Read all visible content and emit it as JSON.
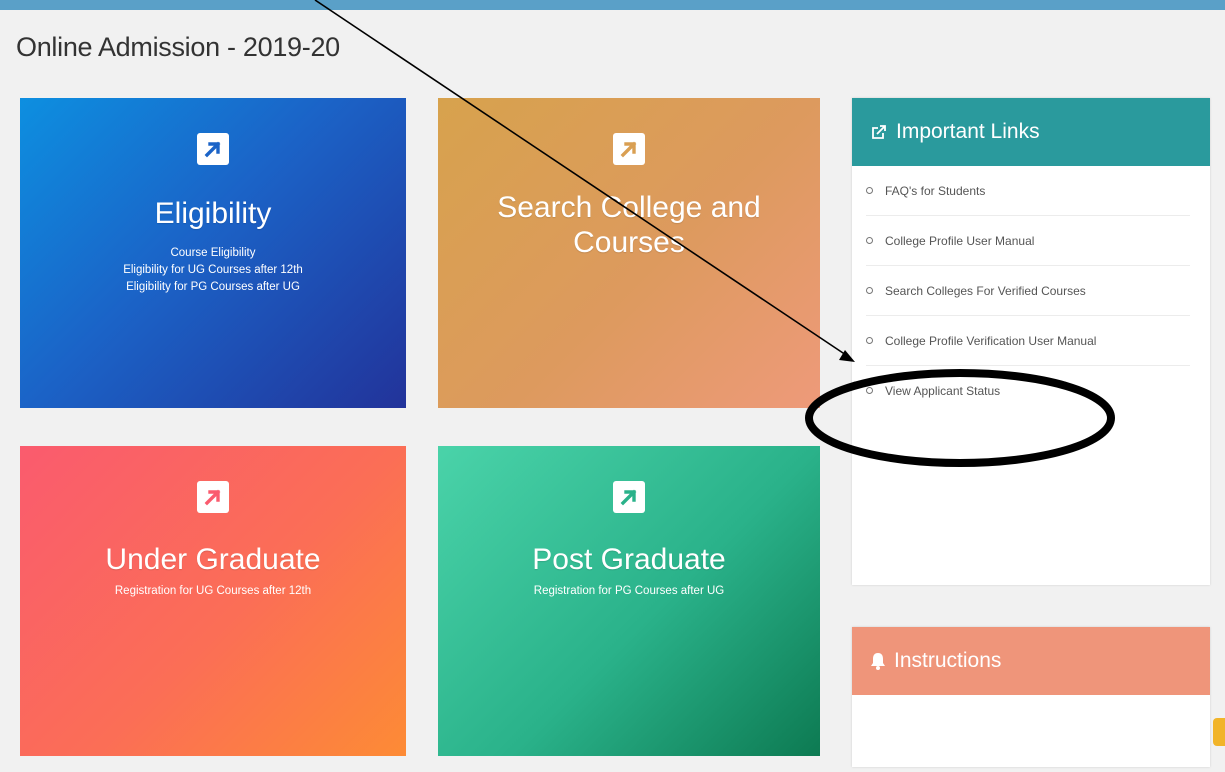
{
  "header": {
    "title": "Online Admission - 2019-20",
    "accent_color": "#5aa0c8"
  },
  "tiles": {
    "eligibility": {
      "icon": "external-link-arrow-icon",
      "title": "Eligibility",
      "lines": [
        "Course Eligibility",
        "Eligibility for UG Courses after 12th",
        "Eligibility for PG Courses after UG"
      ]
    },
    "search": {
      "icon": "external-link-arrow-icon",
      "title": "Search College and Courses"
    },
    "ug": {
      "icon": "external-link-arrow-icon",
      "title": "Under Graduate",
      "lines": [
        "Registration for UG Courses after 12th"
      ]
    },
    "pg": {
      "icon": "external-link-arrow-icon",
      "title": "Post Graduate",
      "lines": [
        "Registration for PG Courses after UG"
      ]
    }
  },
  "important_links": {
    "icon": "external-link-icon",
    "title": "Important Links",
    "header_color": "#2a9a9d",
    "items": [
      {
        "label": "FAQ's for Students"
      },
      {
        "label": "College Profile User Manual"
      },
      {
        "label": "Search Colleges For Verified Courses"
      },
      {
        "label": "College Profile Verification User Manual"
      },
      {
        "label": "View Applicant Status"
      }
    ]
  },
  "instructions": {
    "icon": "bell-icon",
    "title": "Instructions",
    "header_color": "#ef957a"
  },
  "annotation": {
    "arrow_color": "#000000",
    "highlighted_item": "View Applicant Status"
  }
}
